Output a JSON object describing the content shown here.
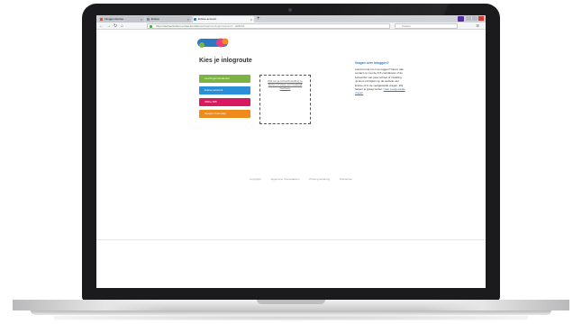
{
  "browser": {
    "tabs": [
      {
        "label": "Inloggen Entree",
        "icon_color": "#d54b3a",
        "active": false
      },
      {
        "label": "Entree",
        "icon_color": "#7b8a9a",
        "active": false
      },
      {
        "label": "Entree account",
        "icon_color": "#2a7ac0",
        "active": true
      }
    ],
    "new_tab_label": "+",
    "url_host": "https://authentication.entree.kennisnet.nl",
    "url_rest": "/web/sso/login/request?...&#8230;",
    "search_placeholder": "Zoeken"
  },
  "page": {
    "heading": "Kies je inlogroute",
    "login_options": [
      {
        "label": "Leerlingen/studenten",
        "color": "#7cb342"
      },
      {
        "label": "Entree-account",
        "color": "#2a8fd6"
      },
      {
        "label": "Office 365",
        "color": "#d81b60"
      },
      {
        "label": "Google Onderwijs",
        "color": "#ef8b1a"
      }
    ],
    "dropbox_text": "Klik om je school/instelling te kiezen of sleep een bestand hierheen",
    "sidebar": {
      "title": "Vragen over inloggen?",
      "text": "Lukt het niet om in te loggen? Neem dan contact op met de ICT-coördinator of de beheerder van jouw school of instelling. Je kunt ook kijken op de website van Entree of in de veelgestelde vragen. Wij helpen je graag verder.",
      "link": "Naar veelgestelde vragen"
    },
    "footer_links": [
      "Copyright",
      "Algemene Voorwaarden",
      "Privacyverklaring",
      "Disclaimer"
    ]
  },
  "colors": {
    "logo_blue": "#2a7ac0",
    "logo_pink": "#e84080",
    "logo_orange": "#f28a1d",
    "logo_green": "#7cb342"
  }
}
